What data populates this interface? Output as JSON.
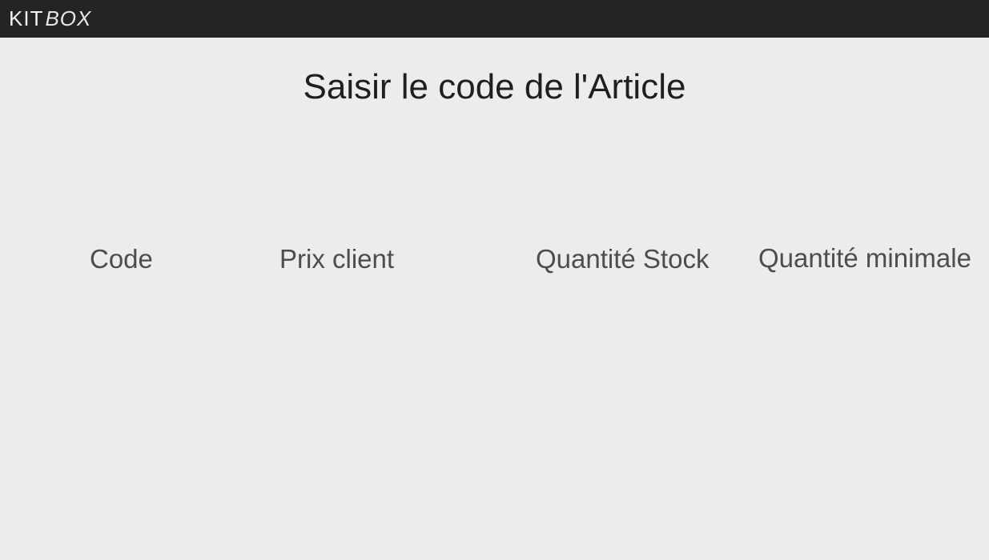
{
  "app": {
    "brand_primary": "KIT",
    "brand_secondary": "BOX"
  },
  "page": {
    "title": "Saisir le code de l'Article"
  },
  "columns": [
    "Code",
    "Prix client",
    "Quantité Stock",
    "Quantité minimale"
  ],
  "colors": {
    "topbar": "#242424",
    "background": "#ececec",
    "title_text": "#1f1f1f",
    "header_text": "#4d4d4d"
  }
}
